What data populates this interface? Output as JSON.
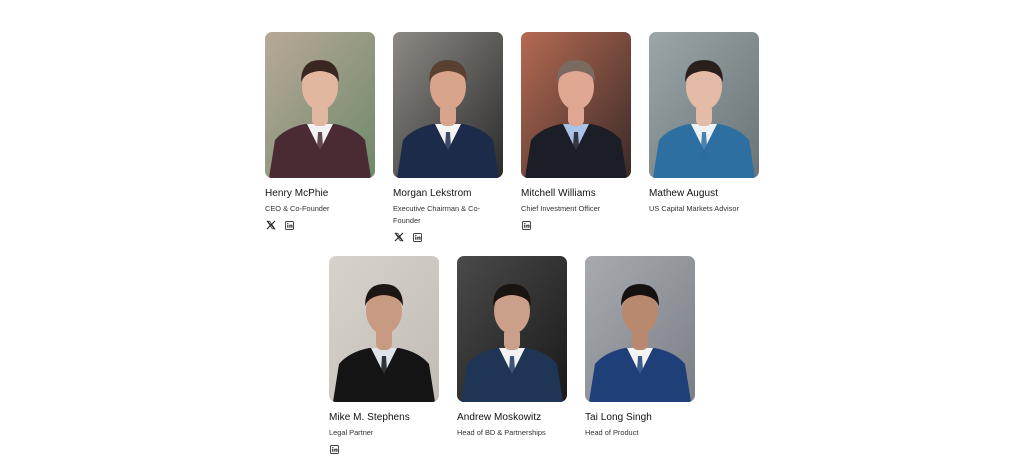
{
  "team": [
    {
      "name": "Henry McPhie",
      "role": "CEO & Co-Founder",
      "socials": [
        "x-icon",
        "linkedin-icon"
      ],
      "colors": {
        "bg1": "#b9a898",
        "bg2": "#6e8a6a",
        "suit": "#4a2b34",
        "shirt": "#f2f2f2",
        "skin": "#e2b7a0",
        "hair": "#3a2620"
      }
    },
    {
      "name": "Morgan Lekstrom",
      "role": "Executive Chairman & Co-Founder",
      "socials": [
        "x-icon",
        "linkedin-icon"
      ],
      "colors": {
        "bg1": "#8d8a84",
        "bg2": "#2b2b2b",
        "suit": "#1d2b4a",
        "shirt": "#f4f4f4",
        "skin": "#d9a48c",
        "hair": "#5a4030"
      }
    },
    {
      "name": "Mitchell Williams",
      "role": "Chief Investment Officer",
      "socials": [
        "linkedin-icon"
      ],
      "colors": {
        "bg1": "#b56a52",
        "bg2": "#3a2a28",
        "suit": "#1b1e26",
        "shirt": "#a9c4e6",
        "skin": "#e0a892",
        "hair": "#7a6a60"
      }
    },
    {
      "name": "Mathew August",
      "role": "US Capital Markets Advisor",
      "socials": [],
      "colors": {
        "bg1": "#9aa6a8",
        "bg2": "#6a7477",
        "suit": "#2d6fa0",
        "shirt": "#eef2f4",
        "skin": "#e4bba6",
        "hair": "#2a1f1a"
      }
    },
    {
      "name": "Mike M. Stephens",
      "role": "Legal Partner",
      "socials": [
        "linkedin-icon"
      ],
      "colors": {
        "bg1": "#d8d2cc",
        "bg2": "#c2bcb6",
        "suit": "#141414",
        "shirt": "#dfe3ea",
        "skin": "#c99a82",
        "hair": "#1e1612"
      }
    },
    {
      "name": "Andrew Moskowitz",
      "role": "Head of BD & Partnerships",
      "socials": [],
      "colors": {
        "bg1": "#4a4a4a",
        "bg2": "#1a1a1a",
        "suit": "#1f3556",
        "shirt": "#f3f3f3",
        "skin": "#caa08a",
        "hair": "#1a1410"
      }
    },
    {
      "name": "Tai Long Singh",
      "role": "Head of Product",
      "socials": [],
      "colors": {
        "bg1": "#a8aab0",
        "bg2": "#7c7f86",
        "suit": "#1f3f78",
        "shirt": "#f4f4f4",
        "skin": "#b9896f",
        "hair": "#141010"
      }
    }
  ]
}
